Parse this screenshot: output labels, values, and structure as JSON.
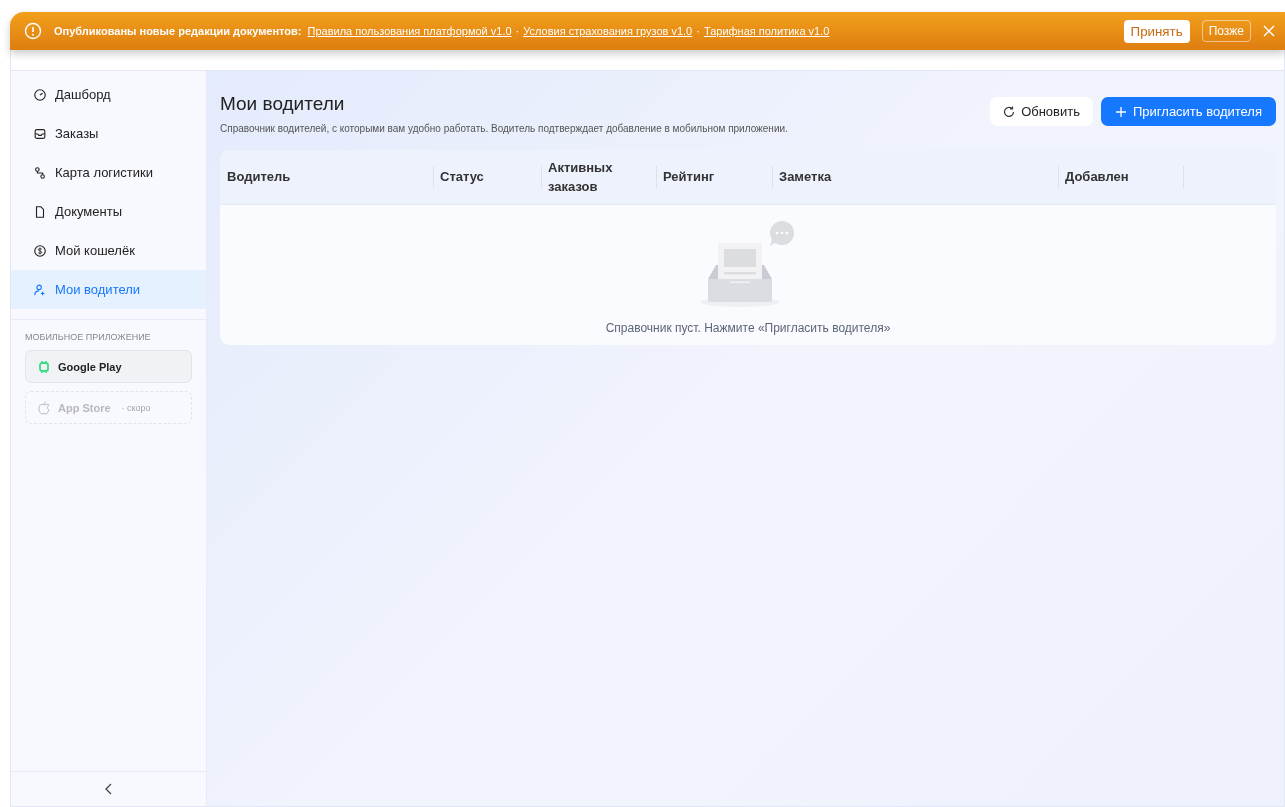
{
  "banner": {
    "lead": "Опубликованы новые редакции документов:",
    "separator": "·",
    "links": [
      "Правила пользования платформой v1.0",
      "Условия страхования грузов v1.0",
      "Тарифная политика v1.0"
    ],
    "accept": "Принять",
    "later": "Позже"
  },
  "sidebar": {
    "items": [
      {
        "label": "Дашборд",
        "selected": false
      },
      {
        "label": "Заказы",
        "selected": false
      },
      {
        "label": "Карта логистики",
        "selected": false
      },
      {
        "label": "Документы",
        "selected": false
      },
      {
        "label": "Мой кошелёк",
        "selected": false
      },
      {
        "label": "Мои водители",
        "selected": true
      }
    ],
    "section_title": "МОБИЛЬНОЕ ПРИЛОЖЕНИЕ",
    "stores": [
      {
        "label": "Google Play",
        "disabled": false
      },
      {
        "label": "App Store",
        "note": "· скоро",
        "disabled": true
      }
    ]
  },
  "page": {
    "title": "Мои водители",
    "subtitle": "Справочник водителей, с которыми вам удобно работать. Водитель подтверждает добавление в мобильном приложении.",
    "refresh": "Обновить",
    "invite": "Пригласить водителя"
  },
  "table": {
    "columns": [
      "Водитель",
      "Статус",
      "Активных заказов",
      "Рейтинг",
      "Заметка",
      "Добавлен"
    ],
    "empty_text": "Справочник пуст. Нажмите «Пригласить водителя»"
  }
}
